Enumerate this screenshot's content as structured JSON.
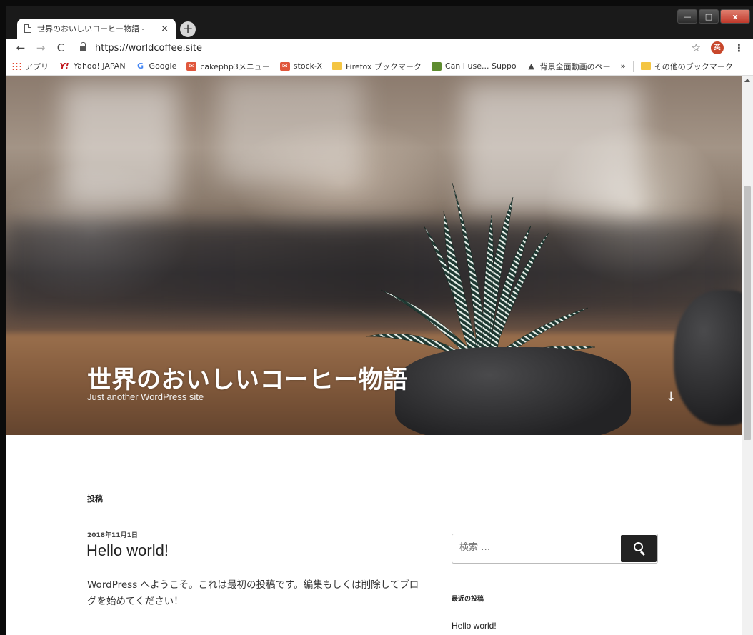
{
  "browser": {
    "tab": {
      "title": "世界のおいしいコーヒー物語 -",
      "close": "×"
    },
    "new_tab": "+",
    "window_controls": {
      "minimize": "—",
      "maximize": "□",
      "close": "x"
    },
    "nav": {
      "back": "←",
      "forward": "→",
      "reload": "C"
    },
    "url": "https://worldcoffee.site",
    "star": "☆",
    "extension_label": "英",
    "menu": "⋮",
    "bookmarks": [
      {
        "label": "アプリ",
        "icon": "apps-icon"
      },
      {
        "label": "Yahoo! JAPAN",
        "icon": "yahoo-icon",
        "glyph": "Y!"
      },
      {
        "label": "Google",
        "icon": "google-icon",
        "glyph": "G"
      },
      {
        "label": "cakephp3メニュー",
        "icon": "cake-icon",
        "glyph": "✉"
      },
      {
        "label": "stock-X",
        "icon": "cake-icon",
        "glyph": "✉"
      },
      {
        "label": "Firefox ブックマーク",
        "icon": "folder-icon"
      },
      {
        "label": "Can I use... Suppo",
        "icon": "caniuse-icon"
      },
      {
        "label": "背景全面動画のペー",
        "icon": "background-icon",
        "glyph": "▲"
      }
    ],
    "bookmarks_more": "»",
    "other_bookmarks": "その他のブックマーク"
  },
  "site": {
    "title": "世界のおいしいコーヒー物語",
    "tagline": "Just another WordPress site",
    "scroll_arrow": "↓"
  },
  "main": {
    "section_label": "投稿",
    "post": {
      "date": "2018年11月1日",
      "title": "Hello world!",
      "body": "WordPress へようこそ。これは最初の投稿です。編集もしくは削除してブログを始めてください！"
    }
  },
  "sidebar": {
    "search_placeholder": "検索 …",
    "recent_title": "最近の投稿",
    "recent_posts": [
      "Hello world!"
    ]
  }
}
